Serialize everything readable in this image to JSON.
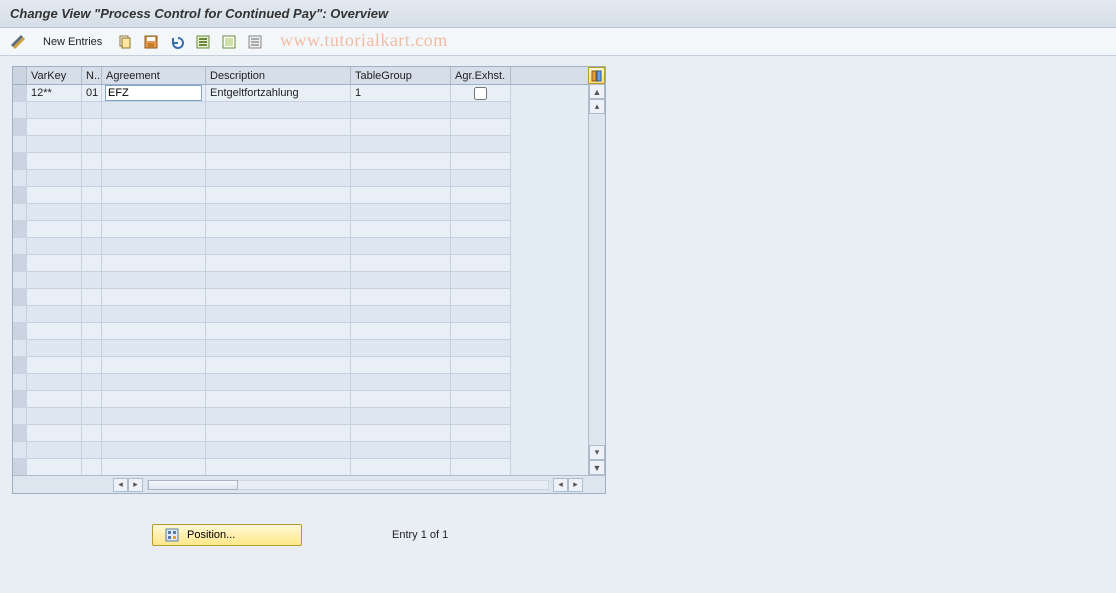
{
  "title": "Change View \"Process Control for Continued Pay\": Overview",
  "watermark": "www.tutorialkart.com",
  "toolbar": {
    "new_entries": "New Entries"
  },
  "columns": {
    "varkey": "VarKey",
    "n": "N..",
    "agreement": "Agreement",
    "description": "Description",
    "tablegroup": "TableGroup",
    "agr_exhst": "Agr.Exhst."
  },
  "row": {
    "varkey": "12**",
    "n": "01",
    "agreement": "EFZ",
    "description": "Entgeltfortzahlung",
    "tablegroup": "1",
    "agr_exhst": false
  },
  "position_label": "Position...",
  "entry_text": "Entry 1 of 1"
}
